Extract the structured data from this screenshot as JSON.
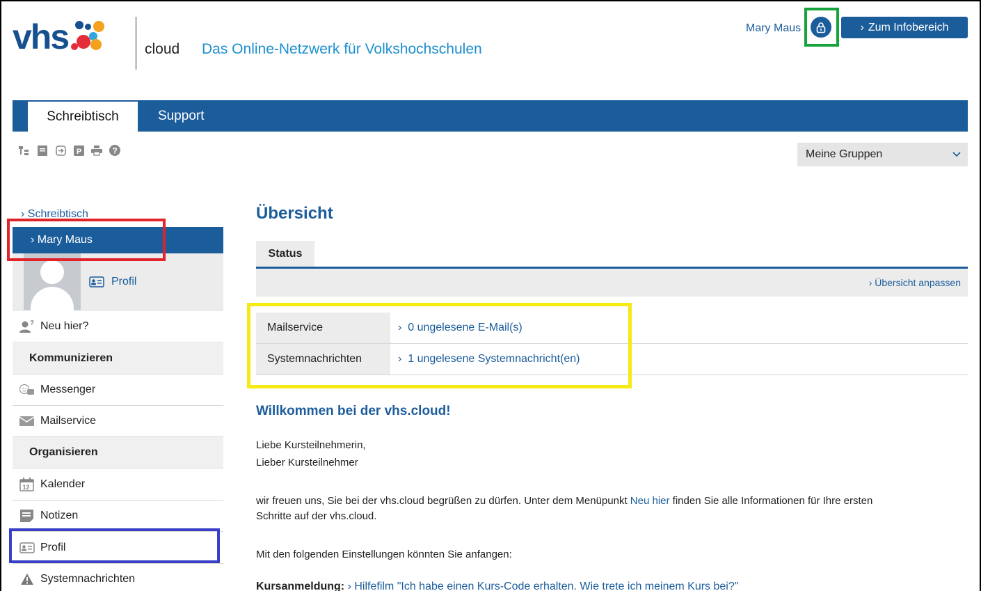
{
  "header": {
    "logo_text": "vhs",
    "logo_suffix": "cloud",
    "tagline": "Das Online-Netzwerk für Volkshochschulen",
    "user_name": "Mary Maus",
    "info_button": "Zum Infobereich"
  },
  "nav": {
    "tabs": [
      {
        "label": "Schreibtisch",
        "active": true
      },
      {
        "label": "Support",
        "active": false
      }
    ]
  },
  "toolbar": {
    "icons": [
      "sitemap-icon",
      "note-icon",
      "export-icon",
      "parking-icon",
      "print-icon",
      "help-icon"
    ],
    "group_select": "Meine Gruppen"
  },
  "sidebar": {
    "breadcrumb": "Schreibtisch",
    "active_item": "Mary Maus",
    "avatar_profile_label": "Profil",
    "items": [
      {
        "type": "item",
        "label": "Neu hier?",
        "icon": "user-question-icon"
      },
      {
        "type": "heading",
        "label": "Kommunizieren"
      },
      {
        "type": "item",
        "label": "Messenger",
        "icon": "messenger-icon"
      },
      {
        "type": "item",
        "label": "Mailservice",
        "icon": "mail-icon"
      },
      {
        "type": "heading",
        "label": "Organisieren"
      },
      {
        "type": "item",
        "label": "Kalender",
        "icon": "calendar-icon"
      },
      {
        "type": "item",
        "label": "Notizen",
        "icon": "note-icon"
      },
      {
        "type": "item",
        "label": "Profil",
        "icon": "profile-card-icon"
      },
      {
        "type": "item",
        "label": "Systemnachrichten",
        "icon": "warning-icon"
      }
    ]
  },
  "main": {
    "title": "Übersicht",
    "tab": "Status",
    "adjust_link": "Übersicht anpassen",
    "status_rows": [
      {
        "label": "Mailservice",
        "value": "0 ungelesene E-Mail(s)"
      },
      {
        "label": "Systemnachrichten",
        "value": "1 ungelesene Systemnachricht(en)"
      }
    ],
    "welcome_title": "Willkommen bei der vhs.cloud!",
    "greeting_line1": "Liebe Kursteilnehmerin,",
    "greeting_line2": "Lieber Kursteilnehmer",
    "intro_before": "wir freuen uns, Sie bei der vhs.cloud begrüßen zu dürfen. Unter dem Menüpunkt ",
    "intro_link": "Neu hier",
    "intro_after": " finden Sie alle Informationen für Ihre ersten",
    "intro_line2": "Schritte auf der vhs.cloud.",
    "settings_intro": "Mit den folgenden Einstellungen könnten Sie anfangen:",
    "kurs_label": "Kursanmeldung:",
    "kurs_link": "Hilfefilm \"Ich habe einen Kurs-Code erhalten. Wie trete ich meinem Kurs bei?\""
  },
  "highlights": {
    "colors": {
      "green": "#16a33c",
      "red": "#e0242b",
      "yellow": "#f5ea14",
      "blue": "#3a3fc8"
    }
  },
  "colors": {
    "brand_blue": "#1b5c9b",
    "tagline_blue": "#1d8fd0"
  }
}
